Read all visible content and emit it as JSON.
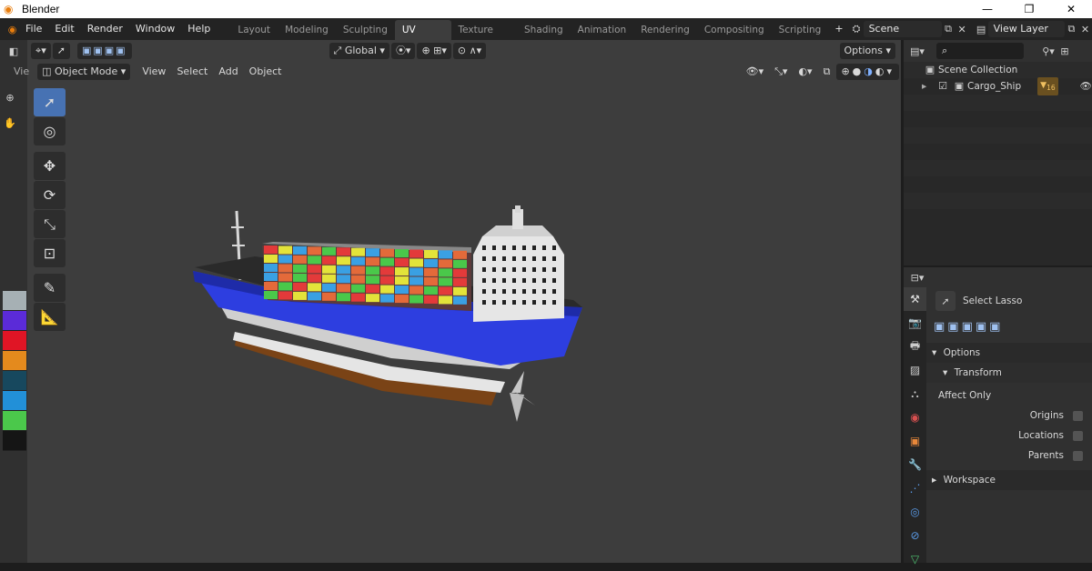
{
  "window": {
    "title": "Blender",
    "minimize": "—",
    "maximize": "❐",
    "close": "✕"
  },
  "menubar": {
    "items": [
      "File",
      "Edit",
      "Render",
      "Window",
      "Help"
    ],
    "tabs": [
      "Layout",
      "Modeling",
      "Sculpting",
      "UV Editing",
      "Texture Paint",
      "Shading",
      "Animation",
      "Rendering",
      "Compositing",
      "Scripting"
    ],
    "active_tab": "UV Editing",
    "add_tab": "+",
    "scene_value": "Scene",
    "view_layer_value": "View Layer"
  },
  "viewport": {
    "transform_orientation": "Global",
    "options_label": "Options",
    "mode_label": "Object Mode",
    "menus": [
      "View",
      "Select",
      "Add",
      "Object"
    ],
    "side_label": "Vie"
  },
  "palette": [
    "#a6b0b4",
    "#5b2bd8",
    "#e01525",
    "#e48a1d",
    "#17485e",
    "#2290d8",
    "#4bc84b",
    "#151515"
  ],
  "outliner": {
    "search_placeholder": "",
    "rows": [
      {
        "label": "Scene Collection",
        "icon": "collection-icon"
      },
      {
        "label": "Cargo_Ship",
        "icon": "collection-icon",
        "badge": "16"
      }
    ]
  },
  "properties": {
    "tool_name": "Select Lasso",
    "options_label": "Options",
    "transform_label": "Transform",
    "affect_only_label": "Affect Only",
    "checkboxes": [
      {
        "label": "Origins",
        "checked": false
      },
      {
        "label": "Locations",
        "checked": false
      },
      {
        "label": "Parents",
        "checked": false
      }
    ],
    "workspace_label": "Workspace"
  },
  "colors": {
    "accent": "#4772b3",
    "viewport_bg": "#3d3d3d",
    "ship_hull_blue": "#2d3ee0"
  }
}
